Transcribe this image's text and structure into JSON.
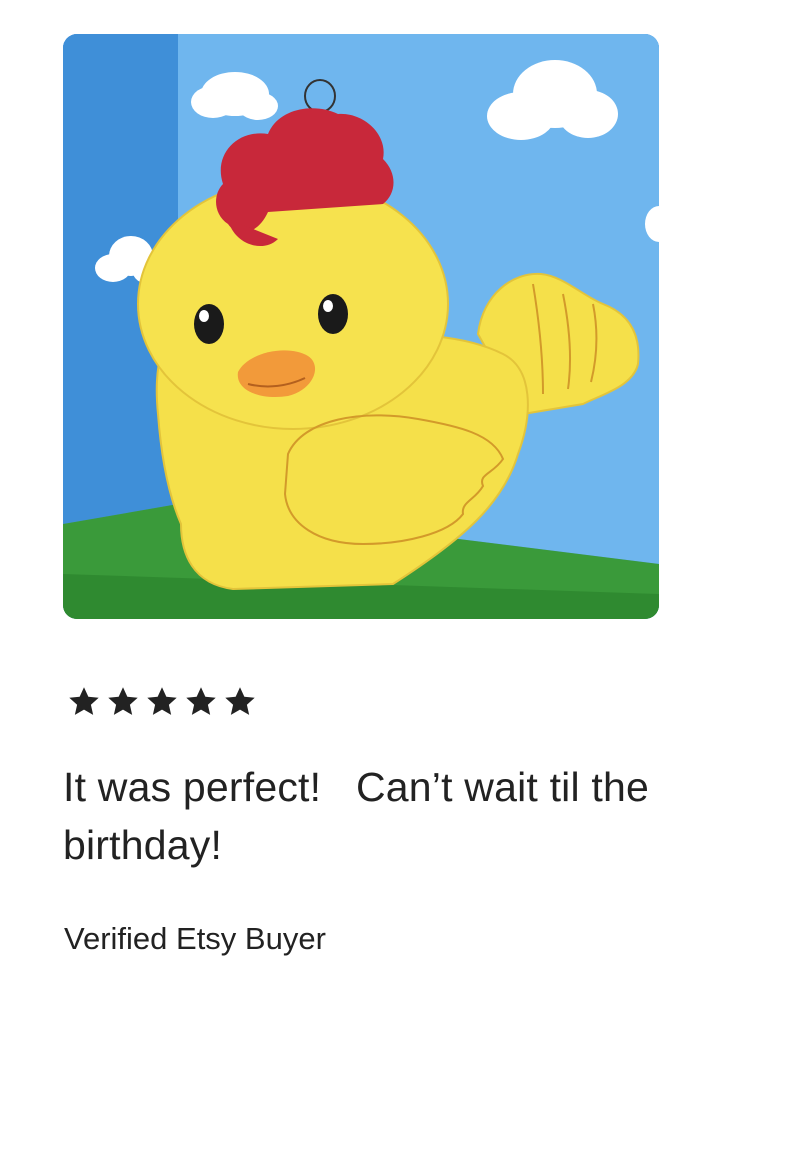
{
  "review": {
    "photo_subject": "yellow-chick-pinata",
    "rating": 5,
    "rating_max": 5,
    "star_icon": "star-icon",
    "text": "It was perfect!   Can’t wait til the birthday!",
    "reviewer": "Verified Etsy Buyer"
  },
  "colors": {
    "text": "#222222",
    "star": "#222222",
    "sky": "#5aa6e6",
    "grass": "#3a9a3a",
    "chick_body": "#f5e04a",
    "comb": "#c8283a",
    "beak": "#f29a3a"
  }
}
